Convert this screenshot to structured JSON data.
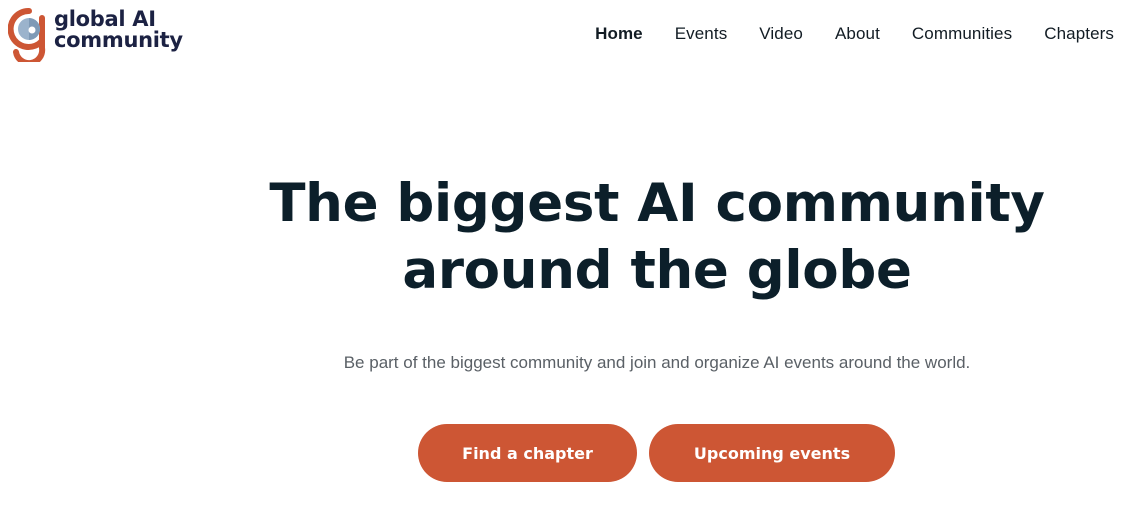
{
  "brand": {
    "line1": "global AI",
    "line2": "community",
    "logo_icon": "global-ai-logo-icon",
    "text_color": "#1c2243",
    "accent_color": "#cd5634",
    "mark_blue": "#9bb3cc"
  },
  "nav": {
    "items": [
      {
        "label": "Home",
        "active": true
      },
      {
        "label": "Events",
        "active": false
      },
      {
        "label": "Video",
        "active": false
      },
      {
        "label": "About",
        "active": false
      },
      {
        "label": "Communities",
        "active": false
      },
      {
        "label": "Chapters",
        "active": false
      }
    ]
  },
  "hero": {
    "title_line1": "The biggest AI community",
    "title_line2": "around the globe",
    "subtitle": "Be part of the biggest community and join and organize AI events around the world.",
    "primary_button": "Find a chapter",
    "secondary_button": "Upcoming events",
    "button_color": "#cd5634"
  }
}
